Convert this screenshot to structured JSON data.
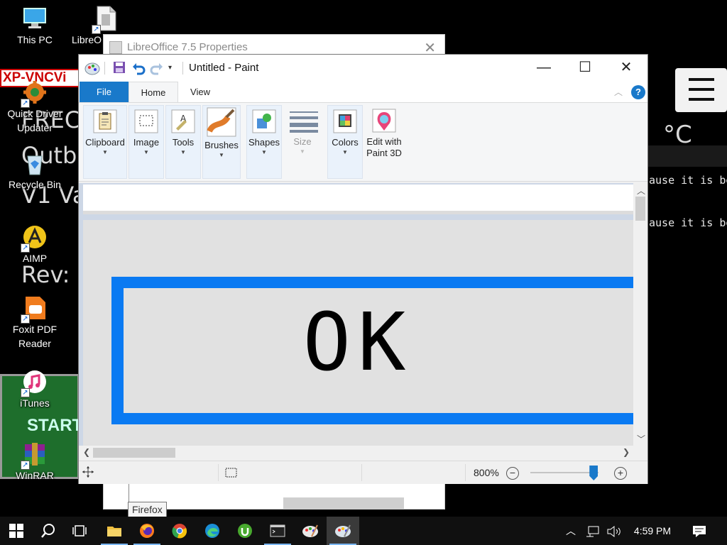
{
  "desktop": {
    "icons": [
      {
        "label": "This PC",
        "name": "this-pc"
      },
      {
        "label": "LibreO",
        "name": "libreoffice"
      },
      {
        "label": "Quick Driver Updater",
        "name": "quick-driver-updater"
      },
      {
        "label": "Recycle Bin",
        "name": "recycle-bin"
      },
      {
        "label": "AIMP",
        "name": "aimp"
      },
      {
        "label": "Foxit PDF Reader",
        "name": "foxit-pdf-reader"
      },
      {
        "label": "iTunes",
        "name": "itunes"
      },
      {
        "label": "WinRAR",
        "name": "winrar"
      }
    ],
    "background": {
      "red_banner": "XP-VNCVi",
      "overlay_text_1": "FREC",
      "overlay_text_2": "Outbu",
      "overlay_text_3": "V1 Va",
      "overlay_text_4": "Rev:",
      "start_text": "START",
      "temp_text": "°C",
      "mono_line_1": "ause it is be",
      "mono_line_2": "ause it is be"
    }
  },
  "libreoffice_window": {
    "title": "LibreOffice 7.5 Properties",
    "close_glyph": "✕"
  },
  "paint": {
    "title": "Untitled - Paint",
    "controls": {
      "minimize": "—",
      "maximize": "☐",
      "close": "✕"
    },
    "tabs": {
      "file": "File",
      "home": "Home",
      "view": "View"
    },
    "help_glyph": "?",
    "groups": {
      "clipboard": "Clipboard",
      "image": "Image",
      "tools": "Tools",
      "brushes": "Brushes",
      "shapes": "Shapes",
      "size": "Size",
      "colors": "Colors",
      "edit_3d_line1": "Edit with",
      "edit_3d_line2": "Paint 3D"
    },
    "canvas": {
      "button_text": "OK"
    },
    "status": {
      "zoom": "800%",
      "zoom_out": "−",
      "zoom_in": "+",
      "zoom_level": 0.93
    }
  },
  "tooltip": {
    "text": "Firefox"
  },
  "taskbar": {
    "items": [
      "start",
      "search",
      "task-view",
      "file-explorer",
      "firefox",
      "chrome",
      "edge",
      "utorrent",
      "cmd",
      "paint-app",
      "paint"
    ],
    "time": "4:59 PM"
  },
  "colors": {
    "accent": "#1979ca",
    "ok_border": "#0a7af2",
    "taskbar": "#101010"
  }
}
